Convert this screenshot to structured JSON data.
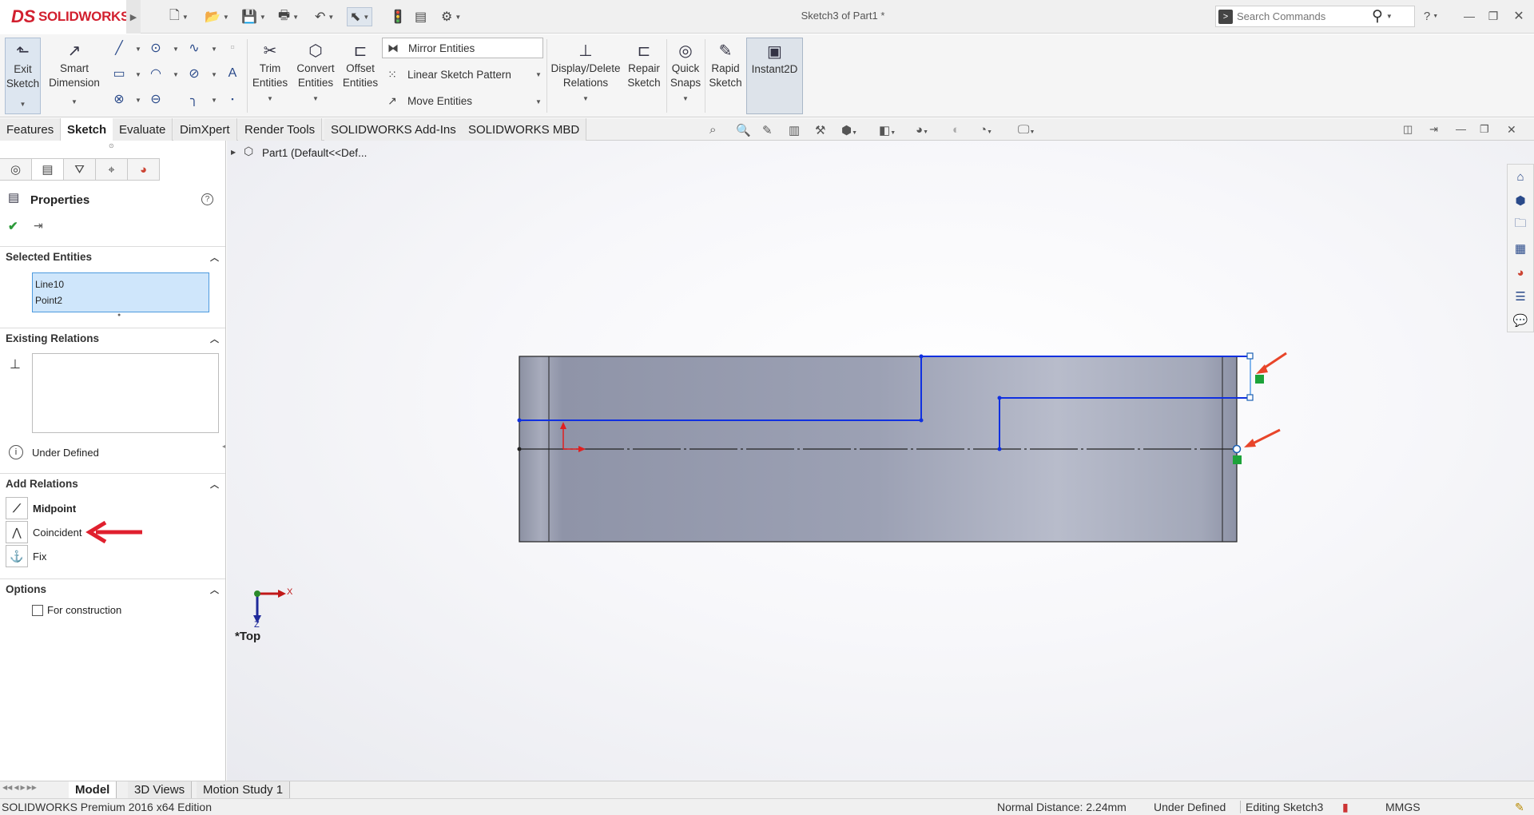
{
  "app": {
    "brand": "SOLIDWORKS",
    "brand_prefix": "DS",
    "title": "Sketch3 of Part1 *"
  },
  "search": {
    "placeholder": "Search Commands"
  },
  "ribbon": {
    "exit_sketch": "Exit\nSketch",
    "smart_dimension": "Smart\nDimension",
    "trim_entities": "Trim\nEntities",
    "convert_entities": "Convert\nEntities",
    "offset_entities": "Offset\nEntities",
    "mirror_entities": "Mirror Entities",
    "linear_sketch_pattern": "Linear Sketch Pattern",
    "move_entities": "Move Entities",
    "display_delete_relations": "Display/Delete\nRelations",
    "repair_sketch": "Repair\nSketch",
    "quick_snaps": "Quick\nSnaps",
    "rapid_sketch": "Rapid\nSketch",
    "instant2d": "Instant2D"
  },
  "tabs": [
    "Features",
    "Sketch",
    "Evaluate",
    "DimXpert",
    "Render Tools",
    "SOLIDWORKS Add-Ins",
    "SOLIDWORKS MBD"
  ],
  "active_tab": "Sketch",
  "tree": {
    "root": "Part1  (Default<<Def..."
  },
  "panel": {
    "title": "Properties",
    "selected_entities_label": "Selected Entities",
    "selected_entities": [
      "Line10",
      "Point2"
    ],
    "existing_relations_label": "Existing Relations",
    "status": "Under Defined",
    "add_relations_label": "Add Relations",
    "relations": [
      "Midpoint",
      "Coincident",
      "Fix"
    ],
    "options_label": "Options",
    "for_construction": "For construction"
  },
  "view": {
    "orientation": "*Top",
    "axis_x": "X",
    "axis_z": "Z"
  },
  "bottom_tabs": [
    "Model",
    "3D Views",
    "Motion Study 1"
  ],
  "status_bar": {
    "edition": "SOLIDWORKS Premium 2016 x64 Edition",
    "normal_distance": "Normal Distance: 2.24mm",
    "definition": "Under Defined",
    "editing": "Editing Sketch3",
    "units": "MMGS"
  },
  "colors": {
    "accent": "#d2202f",
    "sketch_line": "#1030e0",
    "selection_fill": "#cfe6fb",
    "annotation_arrow": "#e8452a",
    "red_arrow": "#e0202e"
  },
  "icons": [
    "home-icon",
    "parts-icon",
    "folder-icon",
    "view-palette-icon",
    "appearance-icon",
    "custom-properties-icon",
    "forum-icon"
  ]
}
